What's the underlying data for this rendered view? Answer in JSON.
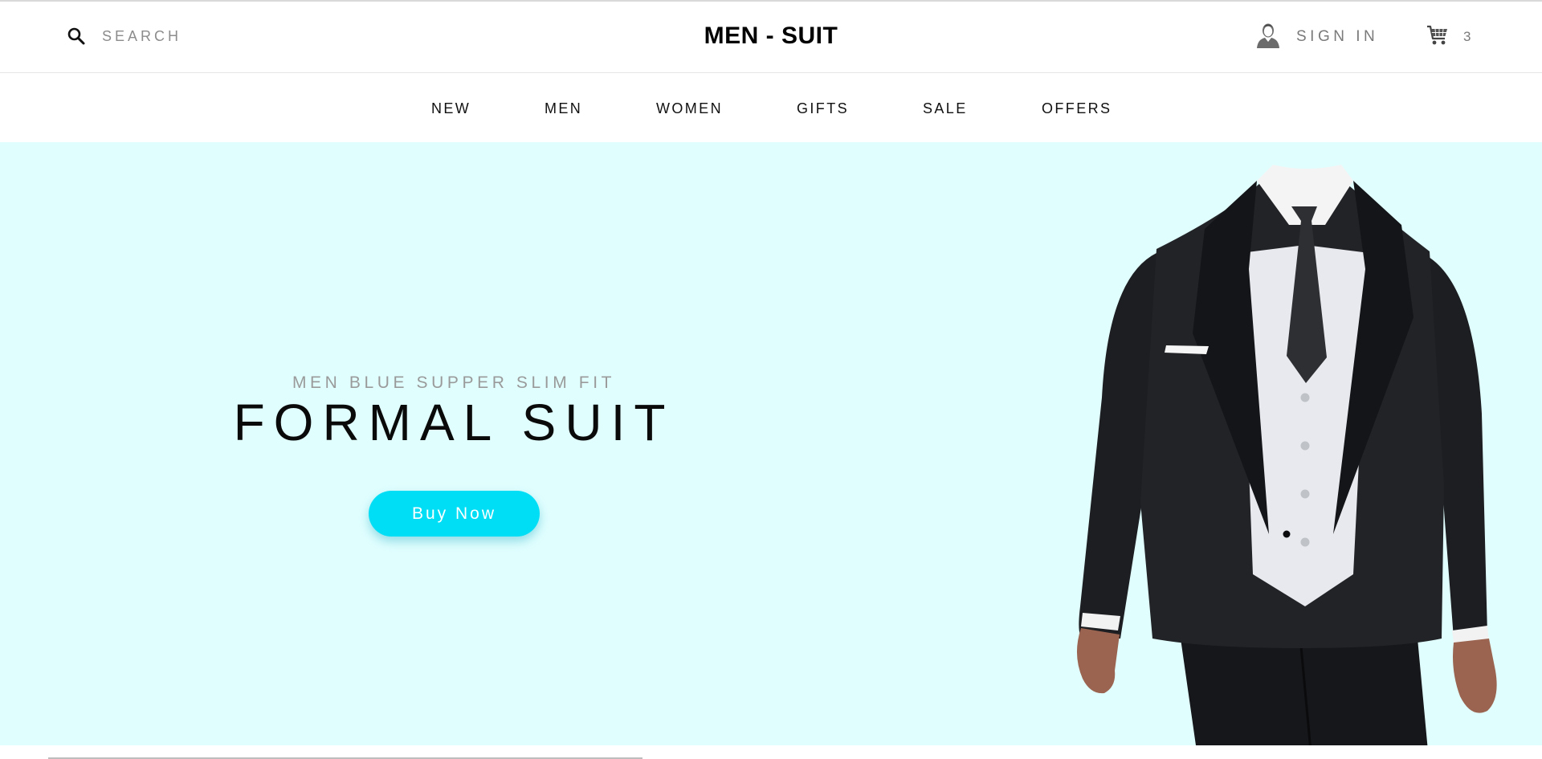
{
  "header": {
    "search": {
      "label": "SEARCH",
      "icon": "search-icon"
    },
    "brand": "MEN - SUIT",
    "sign_in": {
      "label": "SIGN IN",
      "icon": "user-icon"
    },
    "cart": {
      "count": "3",
      "icon": "cart-icon"
    }
  },
  "nav": {
    "items": [
      {
        "label": "NEW"
      },
      {
        "label": "MEN"
      },
      {
        "label": "WOMEN"
      },
      {
        "label": "GIFTS"
      },
      {
        "label": "SALE"
      },
      {
        "label": "OFFERS"
      }
    ]
  },
  "hero": {
    "subtitle": "MEN BLUE SUPPER SLIM FIT",
    "title": "FORMAL SUIT",
    "button_label": "Buy Now",
    "background_color": "#e0fefe",
    "button_color": "#00def5"
  }
}
